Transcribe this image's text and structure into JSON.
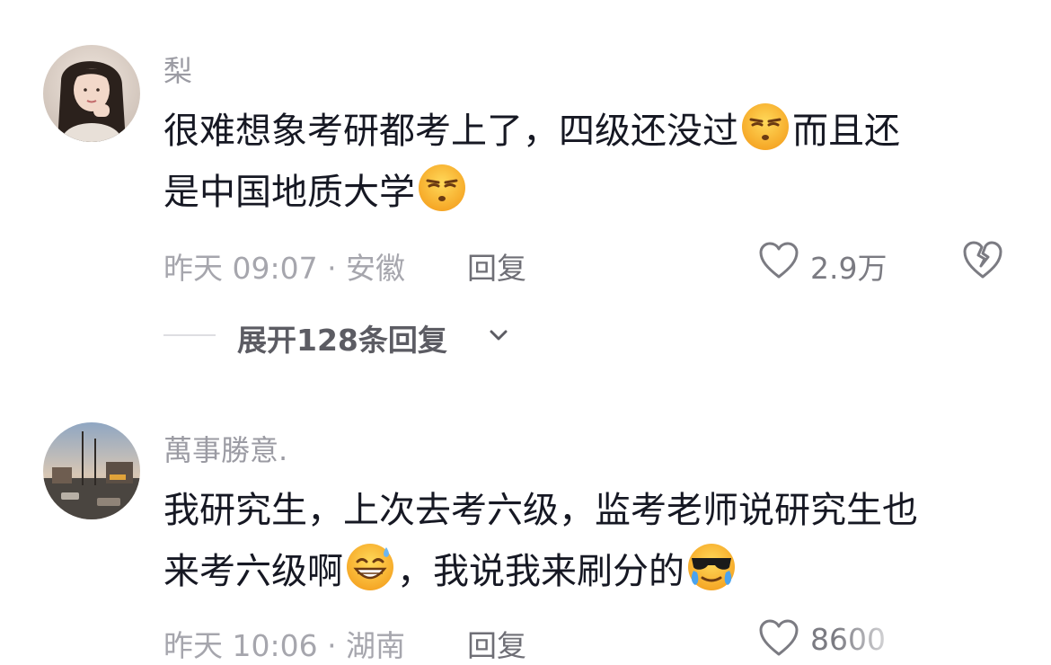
{
  "comments": [
    {
      "username": "梨",
      "content_lines": [
        {
          "before": "很难想象考研都考上了，四级还没过",
          "emoji": "smirk-emoji",
          "after": "而且还"
        },
        {
          "before": "是中国地质大学",
          "emoji": "smirk-emoji",
          "after": ""
        }
      ],
      "time_location": "昨天 09:07 · 安徽",
      "reply_label": "回复",
      "likes": "2.9万",
      "expand_label": "展开128条回复"
    },
    {
      "username": "萬事勝意.",
      "content_lines": [
        {
          "before": "我研究生，上次去考六级，监考老师说研究生也",
          "emoji": "",
          "after": ""
        },
        {
          "before": "来考六级啊",
          "emoji": "sweat-smile-emoji",
          "after": "，我说我来刷分的"
        },
        {
          "before": "",
          "emoji": "cool-cry-emoji",
          "after": ""
        }
      ],
      "time_location": "昨天 10:06 · 湖南",
      "reply_label": "回复",
      "likes": "8600"
    }
  ],
  "icons": {
    "like": "heart-outline-icon",
    "dislike": "broken-heart-icon",
    "expand": "chevron-down-icon"
  },
  "colors": {
    "username": "#9b9ba3",
    "text": "#161823",
    "meta": "#a6a6ad",
    "emoji_yellow": "#fbbf24"
  }
}
